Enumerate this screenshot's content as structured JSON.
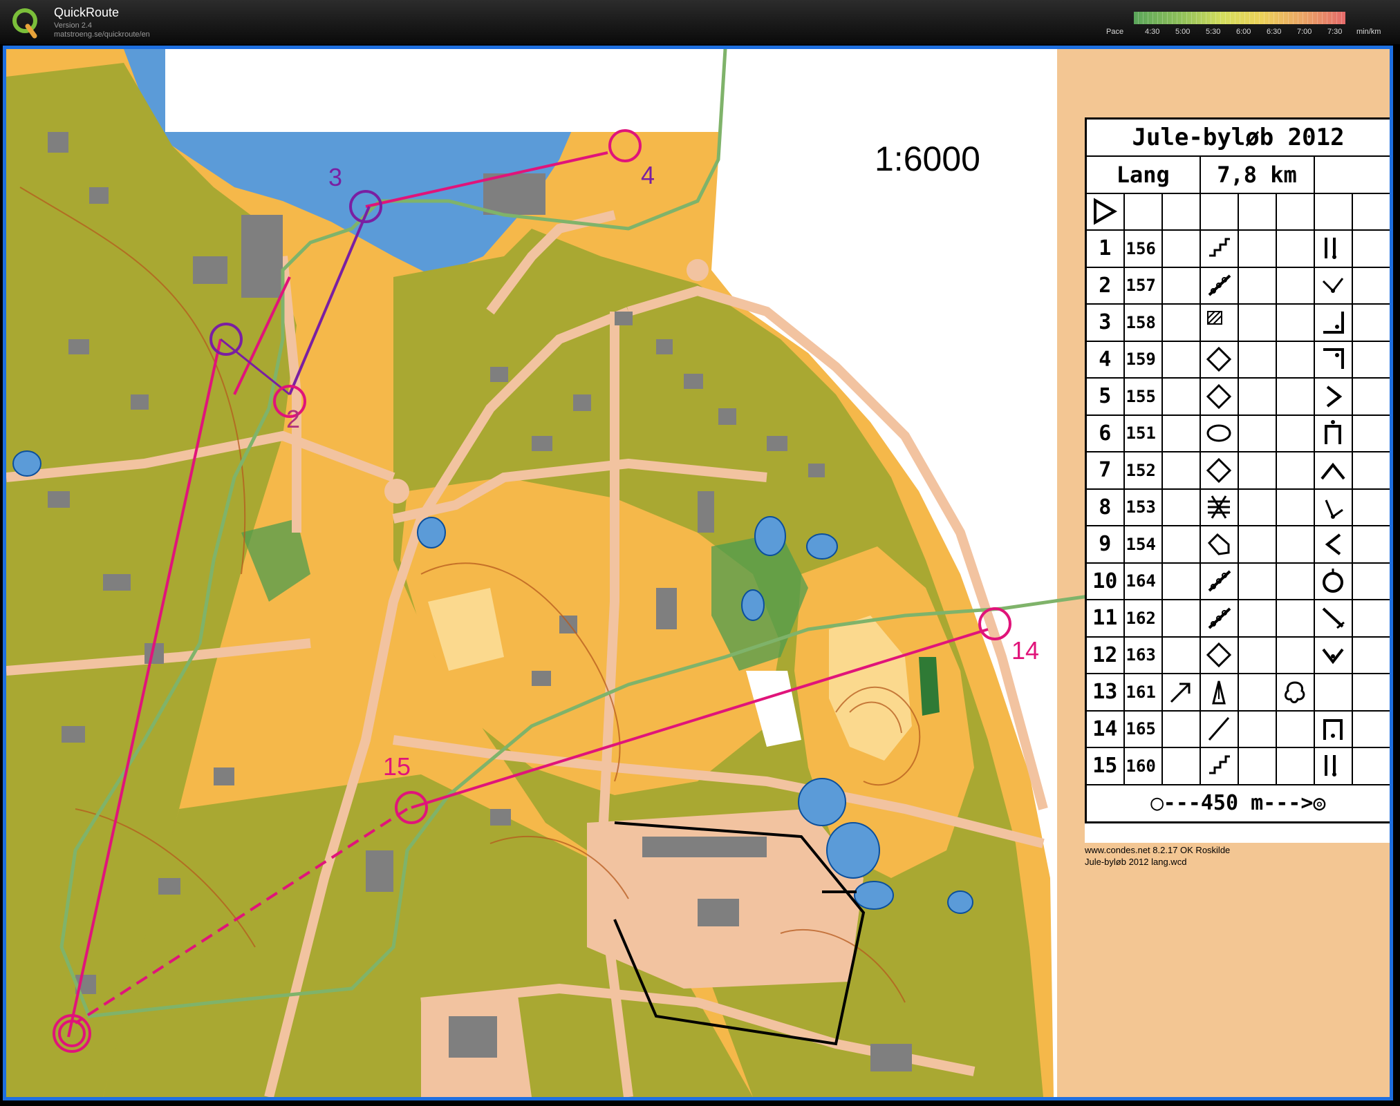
{
  "app": {
    "title": "QuickRoute",
    "version": "Version 2.4",
    "url": "matstroeng.se/quickroute/en",
    "logo_icon": "quickroute-q-logo"
  },
  "pace_scale": {
    "label": "Pace",
    "ticks": [
      "4:30",
      "5:00",
      "5:30",
      "6:00",
      "6:30",
      "7:00",
      "7:30"
    ],
    "unit": "min/km",
    "colors": [
      "#5aa55a",
      "#8fc05a",
      "#d4dd5e",
      "#ecd25a",
      "#eba566",
      "#e56a6a"
    ]
  },
  "map": {
    "scale": "1:6000",
    "colors": {
      "open_land": "#f5b84a",
      "rough_open": "#fbd98e",
      "forest": "#a9a832",
      "green": "#4f9c4d",
      "paved": "#f2c3a0",
      "building": "#7f7f7f",
      "water": "#5b9bd8",
      "course": "#e0147a",
      "route": "#7fb36a"
    },
    "controls": [
      {
        "label": "2"
      },
      {
        "label": "3"
      },
      {
        "label": "4"
      },
      {
        "label": "14"
      },
      {
        "label": "15"
      }
    ]
  },
  "course_card": {
    "title": "Jule-byløb 2012",
    "class": "Lang",
    "length": "7,8 km",
    "start_icon": "start-triangle-icon",
    "rows": [
      {
        "number": "1",
        "code": "156",
        "feature": "earth-bank-icon",
        "where": "",
        "detail": "",
        "position": "foot-icon"
      },
      {
        "number": "2",
        "code": "157",
        "feature": "earth-wall-icon",
        "where": "",
        "detail": "",
        "position": "west-end-icon"
      },
      {
        "number": "3",
        "code": "158",
        "feature": "out-of-bounds-icon",
        "where": "",
        "detail": "",
        "position": "south-east-corner-icon"
      },
      {
        "number": "4",
        "code": "159",
        "feature": "diamond-icon",
        "where": "",
        "detail": "",
        "position": "north-west-corner-icon"
      },
      {
        "number": "5",
        "code": "155",
        "feature": "diamond-icon",
        "where": "",
        "detail": "",
        "position": "east-tip-icon"
      },
      {
        "number": "6",
        "code": "151",
        "feature": "oval-icon",
        "where": "",
        "detail": "",
        "position": "top-icon"
      },
      {
        "number": "7",
        "code": "152",
        "feature": "diamond-icon",
        "where": "",
        "detail": "",
        "position": "north-side-icon"
      },
      {
        "number": "8",
        "code": "153",
        "feature": "crossing-icon",
        "where": "",
        "detail": "",
        "position": "south-west-end-icon"
      },
      {
        "number": "9",
        "code": "154",
        "feature": "building-corner-icon",
        "where": "",
        "detail": "",
        "position": "west-tip-icon"
      },
      {
        "number": "10",
        "code": "164",
        "feature": "earth-wall-icon",
        "where": "",
        "detail": "",
        "position": "circle-top-icon"
      },
      {
        "number": "11",
        "code": "162",
        "feature": "earth-wall-icon",
        "where": "",
        "detail": "",
        "position": "south-east-end-icon"
      },
      {
        "number": "12",
        "code": "163",
        "feature": "diamond-icon",
        "where": "",
        "detail": "",
        "position": "south-tip-icon"
      },
      {
        "number": "13",
        "code": "161",
        "feature": "monument-icon",
        "where": "north-east-arrow-icon",
        "detail": "tree-icon",
        "position": ""
      },
      {
        "number": "14",
        "code": "165",
        "feature": "line-icon",
        "where": "",
        "detail": "",
        "position": "foot-box-icon"
      },
      {
        "number": "15",
        "code": "160",
        "feature": "earth-bank-icon",
        "where": "",
        "detail": "",
        "position": "foot-icon"
      }
    ],
    "finish": {
      "text": "450 m",
      "icon": "finish-circle-icon"
    },
    "footer_line_1": "www.condes.net 8.2.17 OK Roskilde",
    "footer_line_2": "Jule-byløb 2012 lang.wcd"
  }
}
